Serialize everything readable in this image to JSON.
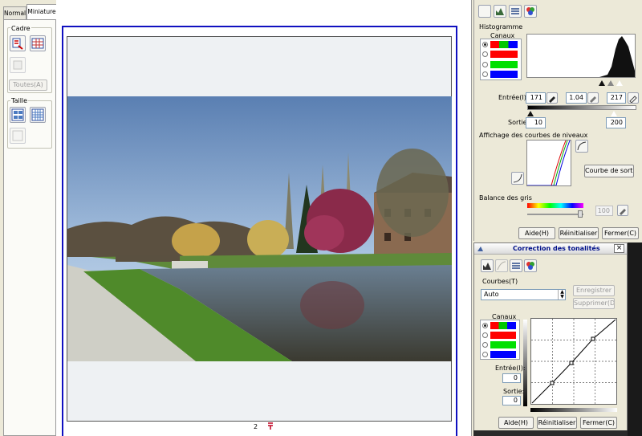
{
  "tabs": {
    "normal": "Normal",
    "miniature": "Miniature"
  },
  "left_panel": {
    "cadre_label": "Cadre",
    "toutes_button": "Toutes(A)",
    "taille_label": "Taille"
  },
  "preview": {
    "page_number": "2"
  },
  "histogram_panel": {
    "section_title": "Histogramme",
    "channels_label": "Canaux",
    "entree_label": "Entrée(I):",
    "entree_black": "171",
    "entree_gamma": "1.04",
    "entree_white": "217",
    "sortie_label": "Sortie:",
    "sortie_black": "10",
    "sortie_white": "200",
    "curves_title": "Affichage des courbes de niveaux",
    "output_curve_button": "Courbe de sortie",
    "gray_balance_title": "Balance des gris",
    "gray_value": "100",
    "help_button": "Aide(H)",
    "reset_button": "Réinitialiser",
    "close_button": "Fermer(C)"
  },
  "tone_dialog": {
    "title": "Correction des tonalités",
    "courbes_label": "Courbes(T)",
    "preset_value": "Auto",
    "save_button": "Enregistrer",
    "delete_button": "Supprimer(D)",
    "channels_label": "Canaux",
    "entree_label": "Entrée(I):",
    "entree_value": "0",
    "sortie_label": "Sortie:",
    "sortie_value": "0",
    "help_button": "Aide(H)",
    "reset_button": "Réinitialiser",
    "close_button": "Fermer(C)",
    "close_x": "×"
  },
  "colors": {
    "channel_rgb": [
      "#ff0000",
      "#00c800",
      "#0000ff"
    ],
    "channel_red": "#ff0000",
    "channel_green": "#00e000",
    "channel_blue": "#0000ff",
    "frame_border": "#1010c0",
    "title_blue": "#00108a"
  }
}
